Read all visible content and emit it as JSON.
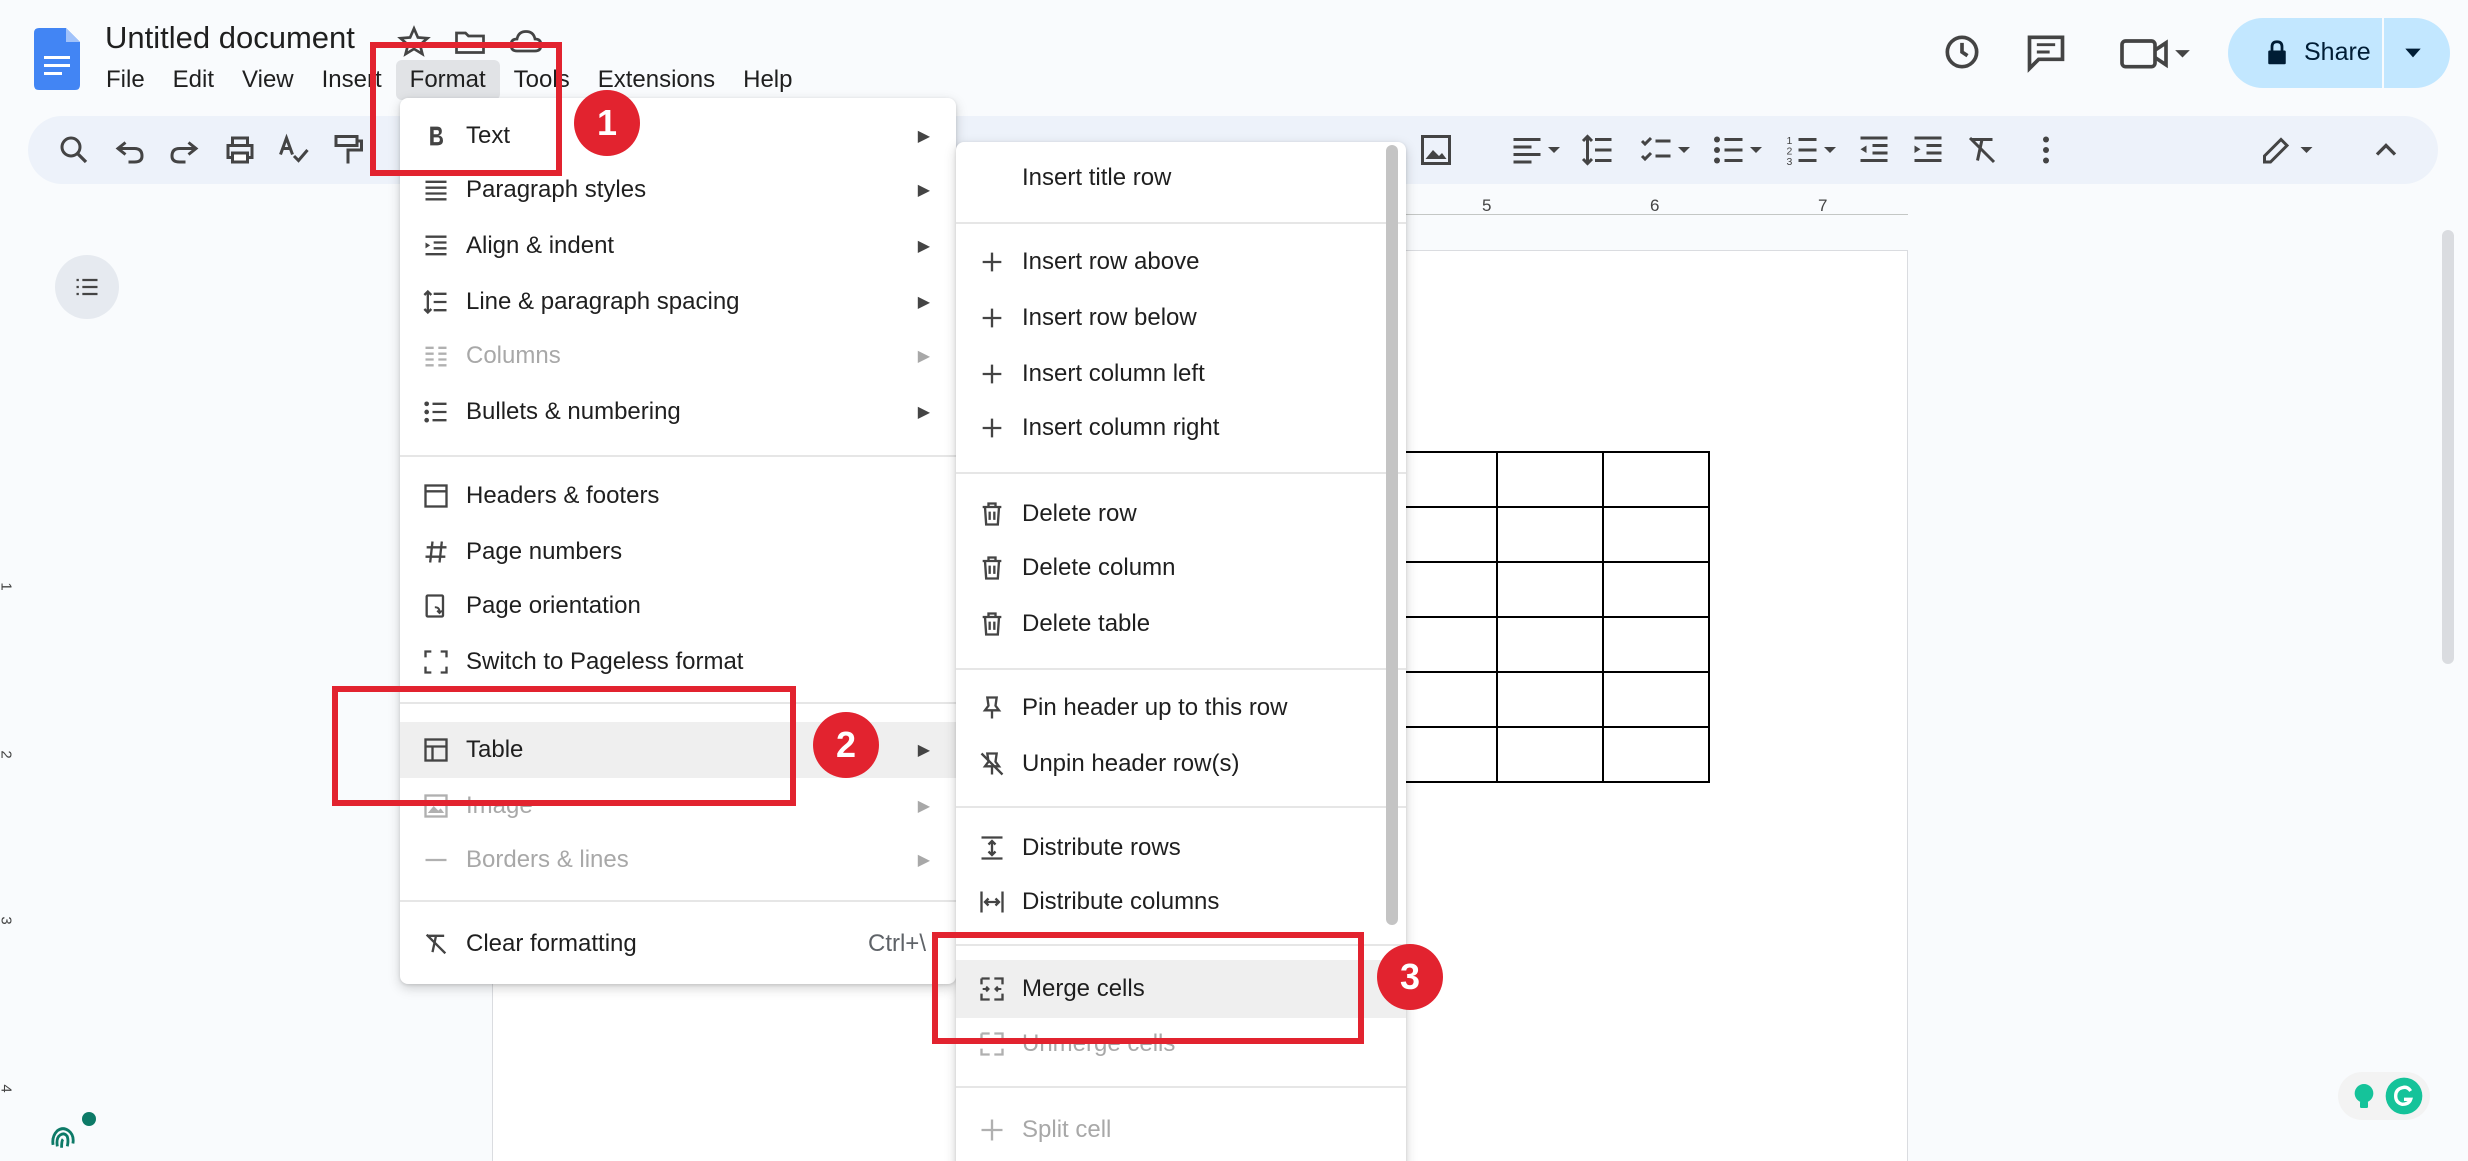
{
  "document": {
    "title": "Untitled document"
  },
  "menubar": {
    "items": [
      "File",
      "Edit",
      "View",
      "Insert",
      "Format",
      "Tools",
      "Extensions",
      "Help"
    ],
    "active": "Format"
  },
  "header": {
    "share_label": "Share"
  },
  "ruler": {
    "labels": [
      "5",
      "6",
      "7"
    ]
  },
  "vertical_ruler": {
    "labels": [
      "1",
      "2",
      "3",
      "4"
    ]
  },
  "format_menu": {
    "items": [
      {
        "label": "Text",
        "icon": "bold-icon",
        "submenu": true
      },
      {
        "label": "Paragraph styles",
        "icon": "paragraph-styles-icon",
        "submenu": true
      },
      {
        "label": "Align & indent",
        "icon": "align-indent-icon",
        "submenu": true
      },
      {
        "label": "Line & paragraph spacing",
        "icon": "line-spacing-icon",
        "submenu": true
      },
      {
        "label": "Columns",
        "icon": "columns-icon",
        "submenu": true,
        "disabled": true
      },
      {
        "label": "Bullets & numbering",
        "icon": "bullets-icon",
        "submenu": true
      },
      {
        "label": "Headers & footers",
        "icon": "headers-footers-icon"
      },
      {
        "label": "Page numbers",
        "icon": "hash-icon"
      },
      {
        "label": "Page orientation",
        "icon": "page-orientation-icon"
      },
      {
        "label": "Switch to Pageless format",
        "icon": "pageless-icon"
      },
      {
        "label": "Table",
        "icon": "table-icon",
        "submenu": true,
        "highlighted": true
      },
      {
        "label": "Image",
        "icon": "image-icon",
        "submenu": true,
        "disabled": true
      },
      {
        "label": "Borders & lines",
        "icon": "borders-icon",
        "submenu": true,
        "disabled": true
      },
      {
        "label": "Clear formatting",
        "icon": "clear-formatting-icon",
        "shortcut": "Ctrl+\\"
      }
    ]
  },
  "table_submenu": {
    "items": [
      {
        "label": "Insert title row"
      },
      {
        "label": "Insert row above",
        "icon": "plus-icon"
      },
      {
        "label": "Insert row below",
        "icon": "plus-icon"
      },
      {
        "label": "Insert column left",
        "icon": "plus-icon"
      },
      {
        "label": "Insert column right",
        "icon": "plus-icon"
      },
      {
        "label": "Delete row",
        "icon": "trash-icon"
      },
      {
        "label": "Delete column",
        "icon": "trash-icon"
      },
      {
        "label": "Delete table",
        "icon": "trash-icon"
      },
      {
        "label": "Pin header up to this row",
        "icon": "pin-icon"
      },
      {
        "label": "Unpin header row(s)",
        "icon": "unpin-icon"
      },
      {
        "label": "Distribute rows",
        "icon": "distribute-rows-icon"
      },
      {
        "label": "Distribute columns",
        "icon": "distribute-columns-icon"
      },
      {
        "label": "Merge cells",
        "icon": "merge-cells-icon",
        "highlighted": true
      },
      {
        "label": "Unmerge cells",
        "icon": "unmerge-cells-icon",
        "disabled": true
      },
      {
        "label": "Split cell",
        "icon": "split-cell-icon",
        "disabled": true
      }
    ]
  },
  "annotations": {
    "badges": [
      "1",
      "2",
      "3"
    ],
    "color": "#e2232f"
  },
  "colors": {
    "accent": "#1a73e8",
    "share_bg": "#c2e7ff",
    "toolbar_bg": "#edf2fa"
  }
}
